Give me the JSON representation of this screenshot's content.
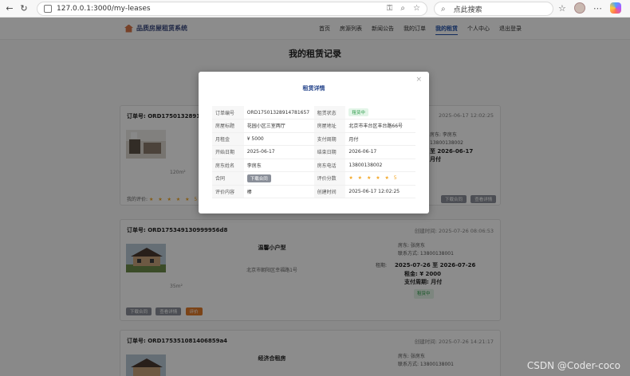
{
  "browser": {
    "url": "127.0.0.1:3000/my-leases",
    "search_placeholder": "点此搜索"
  },
  "site": {
    "brand": "品质房屋租赁系统",
    "menu": [
      "首页",
      "房源列表",
      "新闻公告",
      "我的订单",
      "我的租赁",
      "个人中心",
      "退出登录"
    ],
    "active_menu": "我的租赁",
    "page_title": "我的租赁记录"
  },
  "cards": [
    {
      "order_label": "订单号: ORD17501328914781657",
      "created_time": "2025-06-17 12:02:25",
      "area": "120m²",
      "landlord": "房东: 李房东",
      "contact": "13800138002",
      "period": "至 2026-06-17",
      "pay": "月付",
      "review_label": "我的评价:",
      "stars": "★ ★ ★ ★ ★ 5",
      "buttons": [
        "下载合同",
        "查看详情"
      ]
    },
    {
      "order_label": "订单号: ORD17534913099995​6d8",
      "created_time": "创建时间: 2025-07-26 08:06:53",
      "title": "温馨小户型",
      "address": "北京市朝阳区幸福路1号",
      "area": "35m²",
      "landlord": "房东: 张房东",
      "contact": "联系方式: 13800138001",
      "period_label": "租期:",
      "period": "2025-07-26 至 2026-07-26",
      "rent": "租金: ¥ 2000",
      "pay": "支付周期: 月付",
      "status": "租赁中",
      "buttons": [
        "下载合同",
        "查看详情",
        "评价"
      ]
    },
    {
      "order_label": "订单号: ORD17535108140​6859a4",
      "created_time": "创建时间: 2025-07-26 14:21:17",
      "title": "经济合租房",
      "landlord": "房东: 张房东",
      "contact": "联系方式: 13800138001"
    }
  ],
  "modal": {
    "title": "租赁详情",
    "close": "×",
    "rows": [
      {
        "k1": "订单编号",
        "v1": "ORD17501328914781657",
        "k2": "租赁状态",
        "v2": "租赁中"
      },
      {
        "k1": "房屋标题",
        "v1": "花园小区三室两厅",
        "k2": "房屋地址",
        "v2": "北京市丰台区丰台路66号"
      },
      {
        "k1": "月租金",
        "v1": "¥ 5000",
        "k2": "支付周期",
        "v2": "月付"
      },
      {
        "k1": "开始日期",
        "v1": "2025-06-17",
        "k2": "结束日期",
        "v2": "2026-06-17"
      },
      {
        "k1": "房东姓名",
        "v1": "李房东",
        "k2": "房东电话",
        "v2": "13800138002"
      },
      {
        "k1": "合同",
        "v1": "下载合同",
        "k2": "评价分数",
        "v2": "★ ★ ★ ★ ★ 5"
      },
      {
        "k1": "评价内容",
        "v1": "棒",
        "k2": "创建时间",
        "v2": "2025-06-17 12:02:25"
      }
    ]
  },
  "watermark": "CSDN @Coder-coco"
}
